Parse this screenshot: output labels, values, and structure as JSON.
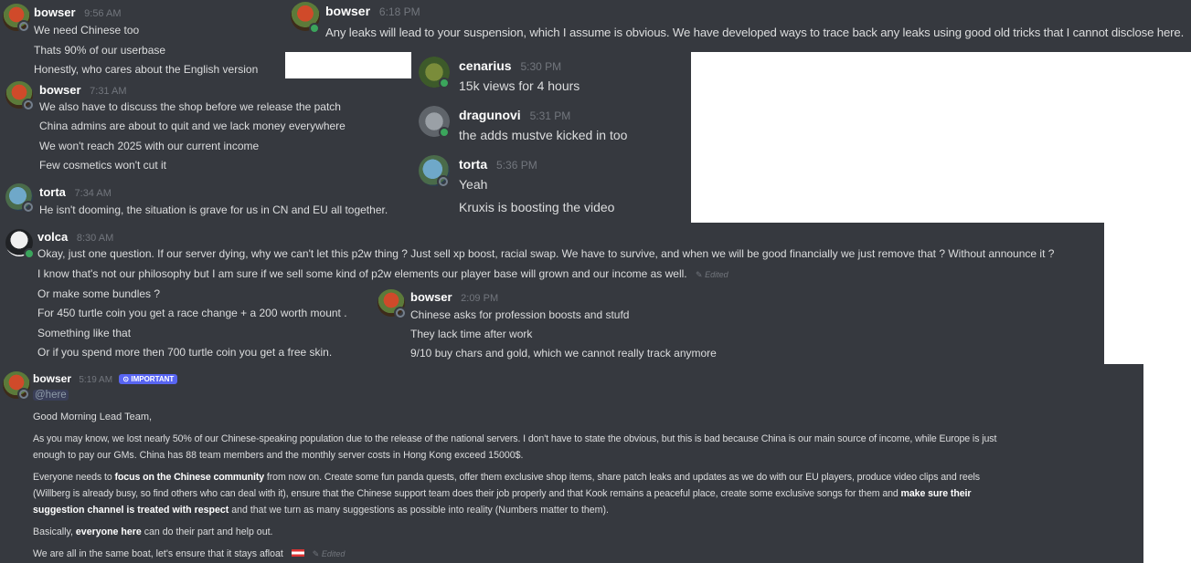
{
  "panel_a": {
    "user": "bowser",
    "time": "9:56 AM",
    "lines": [
      "We need Chinese too",
      "Thats 90% of our userbase",
      "Honestly, who cares about the English version"
    ]
  },
  "panel_b": {
    "user": "bowser",
    "time": "6:18 PM",
    "text": "Any leaks will lead to your suspension, which I assume is obvious. We have developed ways to trace back any leaks using good old tricks that I cannot disclose here."
  },
  "panel_c": {
    "messages": [
      {
        "user": "bowser",
        "time": "7:31 AM",
        "lines": [
          "We also have to discuss the shop before we release the patch",
          "China admins are about to quit and we lack money everywhere",
          "We won't reach 2025 with our current income",
          "Few cosmetics won't cut it"
        ]
      },
      {
        "user": "torta",
        "time": "7:34 AM",
        "lines": [
          "He isn't dooming, the situation is grave for us in CN and EU all together."
        ]
      }
    ]
  },
  "panel_d": {
    "messages": [
      {
        "user": "cenarius",
        "time": "5:30 PM",
        "lines": [
          "15k views for 4 hours"
        ]
      },
      {
        "user": "dragunovi",
        "time": "5:31 PM",
        "lines": [
          "the adds mustve kicked in too"
        ]
      },
      {
        "user": "torta",
        "time": "5:36 PM",
        "lines": [
          "Yeah",
          "Kruxis is boosting the video"
        ]
      }
    ]
  },
  "panel_e": {
    "user": "volca",
    "time": "8:30 AM",
    "line1": "Okay, just one question. If our server dying, why we can't let this p2w thing ? Just sell xp boost, racial swap. We have to survive, and when we will be good financially we just remove that ? Without announce it ?",
    "line2": "I know that's not our philosophy but I am sure if we sell some kind of p2w elements our player base will grown and our income as well.",
    "edited": "Edited",
    "line3": "Or make some bundles ?",
    "line4": "For 450 turtle coin you get a race change + a 200 worth mount .",
    "line5": "Something like that",
    "line6": "Or if you spend more then 700 turtle coin you get a free skin."
  },
  "panel_e_inner": {
    "user": "bowser",
    "time": "2:09 PM",
    "lines": [
      "Chinese asks for profession boosts and stufd",
      "They lack time after work",
      "9/10 buy chars and gold, which we cannot really track anymore"
    ]
  },
  "panel_f": {
    "user": "bowser",
    "time": "5:19 AM",
    "badge": "IMPORTANT",
    "mention": "@here",
    "greeting": "Good Morning Lead Team,",
    "p1a": "As you may know, we lost nearly 50% of our Chinese-speaking population due to the release of the national servers. I don't have to state the obvious, but this is bad because China is our main source of income, while Europe is just",
    "p1b": "enough to pay our GMs. China has 88 team members and the monthly server costs in Hong Kong exceed 15000$.",
    "p2a_1": "Everyone needs to ",
    "p2a_b": "focus on the Chinese community",
    "p2a_2": " from now on. Create some fun panda quests, offer them exclusive shop items, share patch leaks and updates as we do with our EU players, produce video clips and reels",
    "p2b_1": "(Willberg is already busy, so find others who can deal with it), ensure that the Chinese support team does their job properly and that Kook remains a peaceful place, create some exclusive songs for them and ",
    "p2b_b": "make sure their",
    "p2c_b": "suggestion channel is treated with respect",
    "p2c_2": " and that we turn as many suggestions as possible into reality (Numbers matter to them).",
    "p3_1": "Basically, ",
    "p3_b": "everyone here",
    "p3_2": " can do their part and help out.",
    "p4": "We are all in the same boat, let's ensure that it stays afloat",
    "edited": "Edited"
  }
}
